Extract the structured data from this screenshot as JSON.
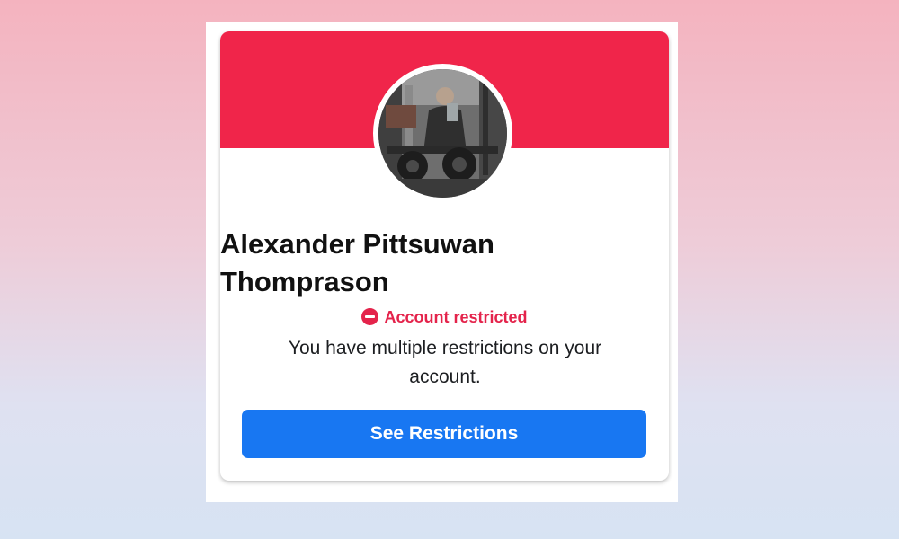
{
  "profile": {
    "name_line1": "Alexander Pittsuwan",
    "name_line2": "Thomprason"
  },
  "restriction": {
    "status_label": "Account restricted",
    "description": "You have multiple restrictions on your account.",
    "button_label": "See Restrictions"
  },
  "colors": {
    "cover": "#f0254a",
    "alert": "#e4234b",
    "button": "#1877f2"
  }
}
